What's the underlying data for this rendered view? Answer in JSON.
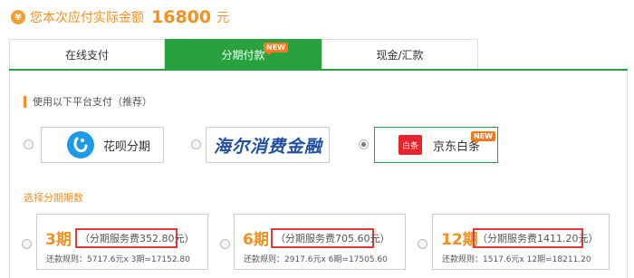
{
  "summary": {
    "icon": "yen-icon",
    "yen_glyph": "¥",
    "label": "您本次应付实际金额",
    "amount": "16800",
    "unit": "元"
  },
  "tabs": [
    {
      "label": "在线支付",
      "active": false
    },
    {
      "label": "分期付款",
      "active": true,
      "badge": "NEW"
    },
    {
      "label": "现金/汇款",
      "active": false
    }
  ],
  "platform_section": {
    "title": "使用以下平台支付（推荐）"
  },
  "platforms": [
    {
      "label": "花呗分期",
      "icon": "huabei-logo-icon",
      "selected": false
    },
    {
      "label": "海尔消费金融",
      "icon": "haier-consumer-finance-logo",
      "selected": false
    },
    {
      "label": "京东白条",
      "logo_text": "白条",
      "icon": "jd-baitiao-logo-icon",
      "selected": true,
      "badge": "NEW"
    }
  ],
  "installment_section": {
    "title": "选择分期期数"
  },
  "plans": [
    {
      "period": "3期",
      "fee": "（分期服务费352.80元）",
      "rule": "还款规则：5717.6元x 3期=17152.80"
    },
    {
      "period": "6期",
      "fee": "（分期服务费705.60元）",
      "rule": "还款规则：2917.6元x 6期=17505.60"
    },
    {
      "period": "12期",
      "fee": "（分期服务费1411.20元）",
      "rule": "还款规则：1517.6元x 12期=18211.20"
    }
  ],
  "colors": {
    "accent_orange": "#f29020",
    "brand_green": "#2aa13f",
    "highlight_red": "#e53935"
  }
}
